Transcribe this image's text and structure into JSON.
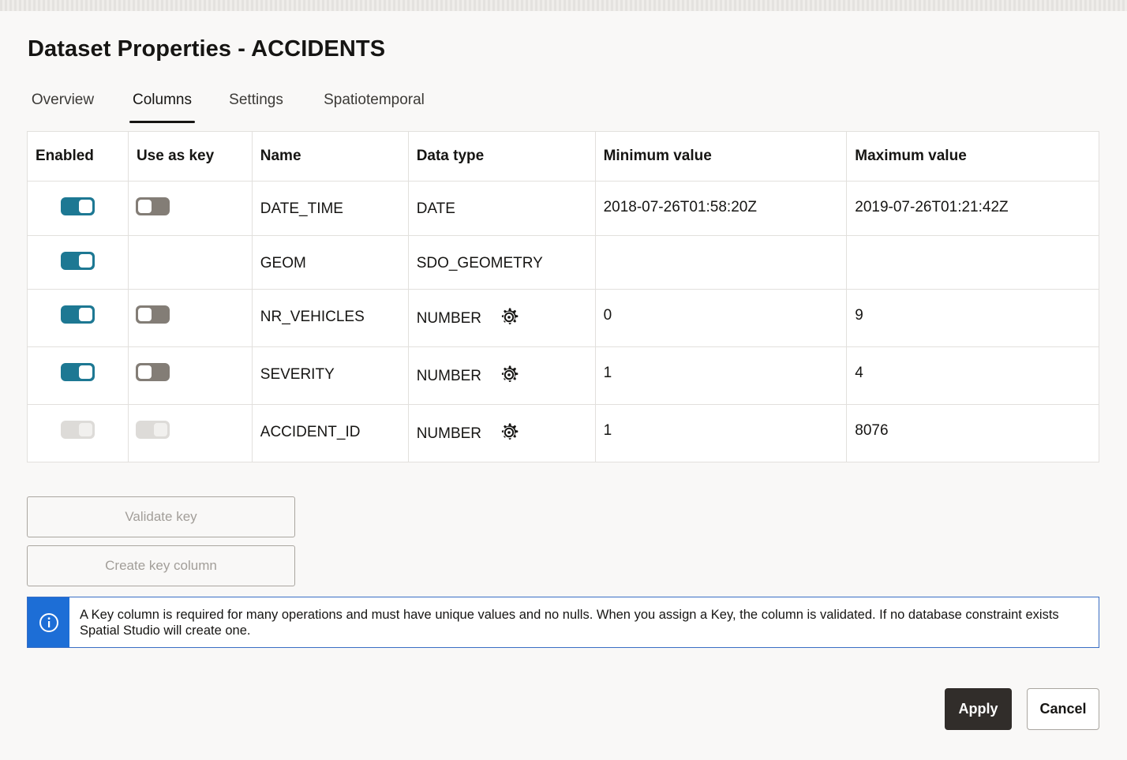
{
  "title": "Dataset Properties - ACCIDENTS",
  "tabs": [
    {
      "label": "Overview"
    },
    {
      "label": "Columns"
    },
    {
      "label": "Settings"
    },
    {
      "label": "Spatiotemporal"
    }
  ],
  "active_tab": "Columns",
  "table": {
    "headers": [
      "Enabled",
      "Use as key",
      "Name",
      "Data type",
      "Minimum value",
      "Maximum value"
    ],
    "rows": [
      {
        "enabled": "on",
        "key": "off",
        "name": "DATE_TIME",
        "type": "DATE",
        "gear": false,
        "min": "2018-07-26T01:58:20Z",
        "max": "2019-07-26T01:21:42Z"
      },
      {
        "enabled": "on",
        "key": "none",
        "name": "GEOM",
        "type": "SDO_GEOMETRY",
        "gear": false,
        "min": "",
        "max": ""
      },
      {
        "enabled": "on",
        "key": "off",
        "name": "NR_VEHICLES",
        "type": "NUMBER",
        "gear": true,
        "min": "0",
        "max": "9"
      },
      {
        "enabled": "on",
        "key": "off",
        "name": "SEVERITY",
        "type": "NUMBER",
        "gear": true,
        "min": "1",
        "max": "4"
      },
      {
        "enabled": "disabled",
        "key": "disabled",
        "name": "ACCIDENT_ID",
        "type": "NUMBER",
        "gear": true,
        "min": "1",
        "max": "8076"
      }
    ]
  },
  "buttons": {
    "validate_key": "Validate key",
    "create_key_column": "Create key column",
    "apply": "Apply",
    "cancel": "Cancel"
  },
  "info": {
    "icon": "info-icon",
    "text": "A Key column is required for many operations and must have unique values and no nulls. When you assign a Key, the column is validated. If no database constraint exists Spatial Studio will create one."
  },
  "colors": {
    "toggle_on": "#1d7893",
    "toggle_off": "#837d76",
    "info_accent": "#1d6ed6",
    "primary_button": "#312d2a"
  }
}
